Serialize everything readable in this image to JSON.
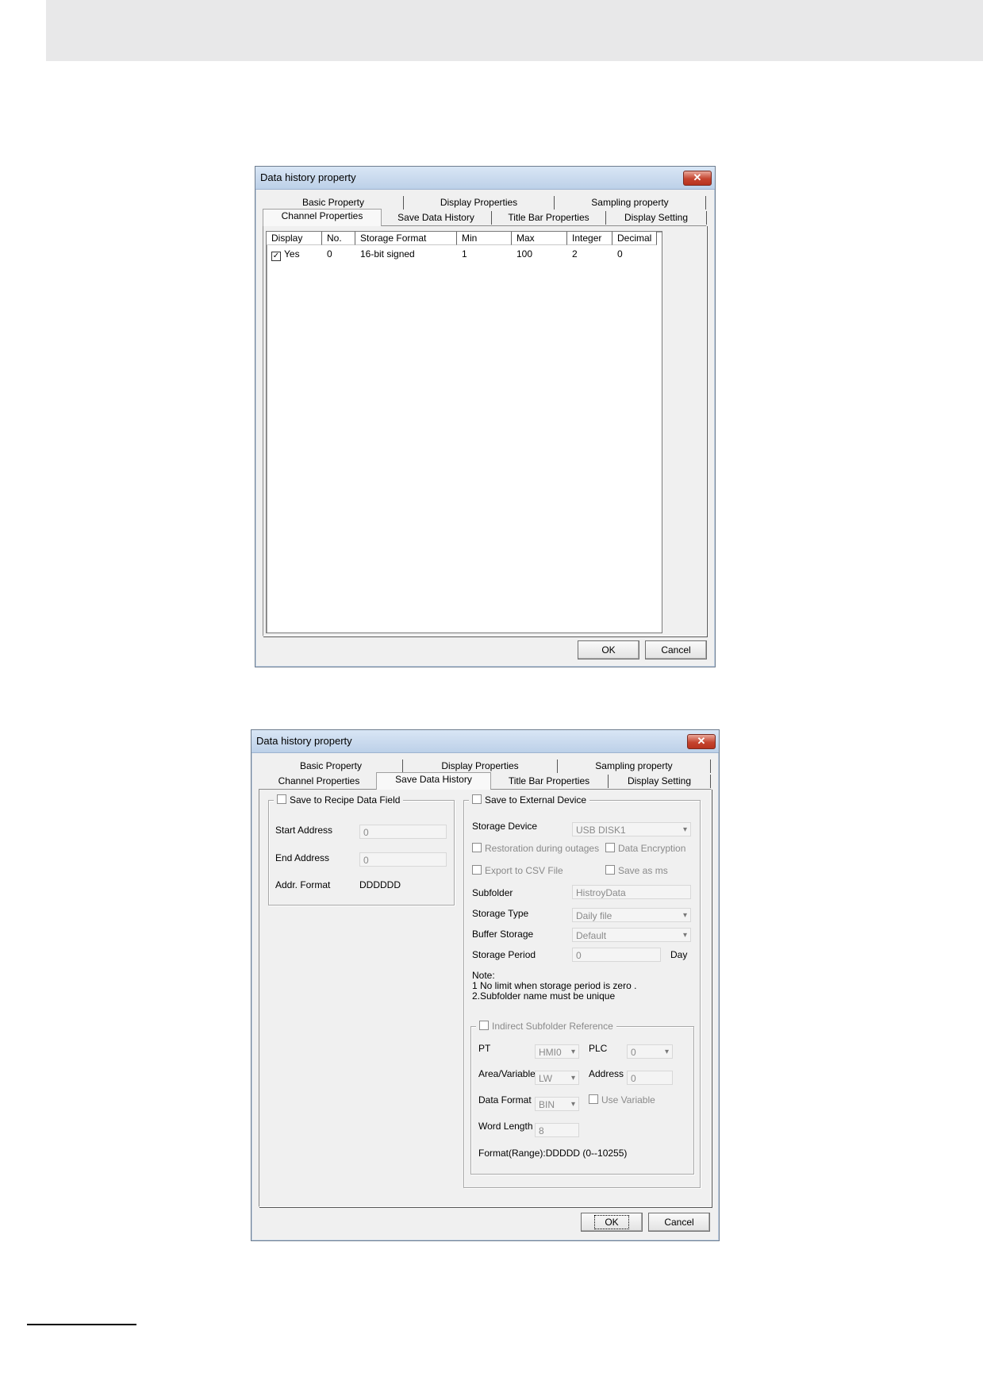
{
  "dialog1": {
    "title": "Data history property",
    "close": "✕",
    "tabs_row1": [
      "Basic Property",
      "Display Properties",
      "Sampling property"
    ],
    "tabs_row2": [
      "Channel Properties",
      "Save Data History",
      "Title Bar Properties",
      "Display Setting"
    ],
    "active_tab": "Channel Properties",
    "table": {
      "columns": [
        "Display",
        "No.",
        "Storage Format",
        "Min",
        "Max",
        "Integer",
        "Decimal"
      ],
      "rows": [
        {
          "check": "✓",
          "display": "Yes",
          "no": "0",
          "format": "16-bit signed",
          "min": "1",
          "max": "100",
          "integer": "2",
          "decimal": "0"
        }
      ]
    },
    "ok": "OK",
    "cancel": "Cancel"
  },
  "dialog2": {
    "title": "Data history property",
    "close": "✕",
    "tabs_row1": [
      "Basic Property",
      "Display Properties",
      "Sampling property"
    ],
    "tabs_row2": [
      "Channel Properties",
      "Save Data History",
      "Title Bar Properties",
      "Display Setting"
    ],
    "active_tab": "Save Data History",
    "recipe": {
      "legend": "Save to Recipe Data Field",
      "start_label": "Start Address",
      "start_value": "0",
      "end_label": "End Address",
      "end_value": "0",
      "format_label": "Addr. Format",
      "format_value": "DDDDDD"
    },
    "external": {
      "legend": "Save to External Device",
      "device_label": "Storage Device",
      "device_value": "USB DISK1",
      "restoration": "Restoration during outages",
      "encryption": "Data Encryption",
      "csv": "Export to CSV File",
      "save_ms": "Save as ms",
      "subfolder_label": "Subfolder",
      "subfolder_value": "HistroyData",
      "type_label": "Storage Type",
      "type_value": "Daily file",
      "buffer_label": "Buffer Storage",
      "buffer_value": "Default",
      "period_label": "Storage Period",
      "period_value": "0",
      "period_unit": "Day",
      "note_title": "Note:",
      "note_1": "1 No limit when storage period is zero .",
      "note_2": "2.Subfolder name must be unique"
    },
    "indirect": {
      "legend": "Indirect Subfolder Reference",
      "pt_label": "PT",
      "pt_value": "HMI0",
      "plc_label": "PLC",
      "plc_value": "0",
      "area_label": "Area/Variable",
      "area_value": "LW",
      "address_label": "Address",
      "address_value": "0",
      "data_format_label": "Data Format",
      "data_format_value": "BIN",
      "use_variable": "Use Variable",
      "word_length_label": "Word Length",
      "word_length_value": "8",
      "format_range": "Format(Range):DDDDD (0--10255)"
    },
    "ok": "OK",
    "cancel": "Cancel"
  }
}
